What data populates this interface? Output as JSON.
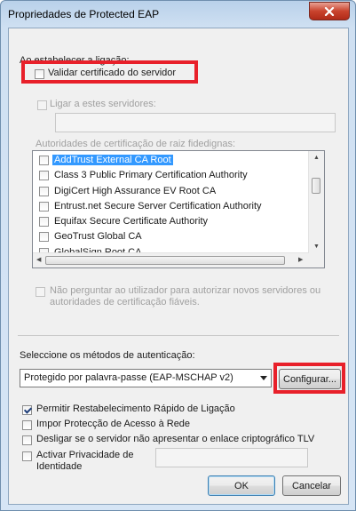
{
  "window": {
    "title": "Propriedades de Protected EAP"
  },
  "validation": {
    "section_label": "Ao estabelecer a ligação:",
    "validate_cert_label": "Validar certificado do servidor",
    "validate_cert_checked": false,
    "connect_servers_label": "Ligar a estes servidores:",
    "connect_servers_checked": false,
    "servers_value": "",
    "trusted_roots_label": "Autoridades de certificação de raiz fidedignas:",
    "certificates": [
      {
        "label": "AddTrust External CA Root",
        "checked": false,
        "selected": true
      },
      {
        "label": "Class 3 Public Primary Certification Authority",
        "checked": false,
        "selected": false
      },
      {
        "label": "DigiCert High Assurance EV Root CA",
        "checked": false,
        "selected": false
      },
      {
        "label": "Entrust.net Secure Server Certification Authority",
        "checked": false,
        "selected": false
      },
      {
        "label": "Equifax Secure Certificate Authority",
        "checked": false,
        "selected": false
      },
      {
        "label": "GeoTrust Global CA",
        "checked": false,
        "selected": false
      },
      {
        "label": "GlobalSign Root CA",
        "checked": false,
        "selected": false
      }
    ],
    "no_prompt_label_line1": "Não perguntar ao utilizador para autorizar novos servidores ou",
    "no_prompt_label_line2": "autoridades de certificação fiáveis.",
    "no_prompt_checked": false
  },
  "auth": {
    "method_label": "Seleccione os métodos de autenticação:",
    "method_selected": "Protegido por palavra-passe (EAP-MSCHAP v2)",
    "configure_label": "Configurar..."
  },
  "options": [
    {
      "key": "fast_reconnect",
      "label": "Permitir Restabelecimento Rápido de Ligação",
      "checked": true
    },
    {
      "key": "nap",
      "label": "Impor Protecção de Acesso à Rede",
      "checked": false
    },
    {
      "key": "crypto_binding",
      "label": "Desligar se o servidor não apresentar o enlace criptográfico TLV",
      "checked": false
    }
  ],
  "privacy": {
    "label_line1": "Activar Privacidade de",
    "label_line2": "Identidade",
    "checked": false,
    "value": ""
  },
  "buttons": {
    "ok_label": "OK",
    "cancel_label": "Cancelar"
  },
  "colors": {
    "highlight": "#e8202a",
    "selection": "#3399ff"
  },
  "icons": {
    "close": "close-icon",
    "dropdown": "chevron-down-icon"
  }
}
